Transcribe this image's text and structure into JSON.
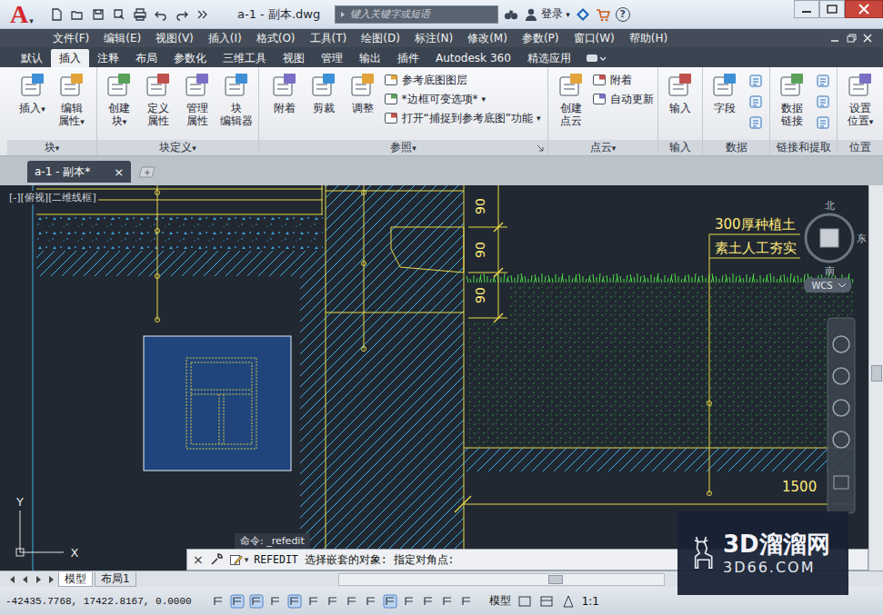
{
  "window": {
    "title": "a-1 - 副本.dwg",
    "logo": "A"
  },
  "search": {
    "placeholder": "键入关键字或短语"
  },
  "account": {
    "label": "登录",
    "help": "?"
  },
  "menu": [
    "文件(F)",
    "编辑(E)",
    "视图(V)",
    "插入(I)",
    "格式(O)",
    "工具(T)",
    "绘图(D)",
    "标注(N)",
    "修改(M)",
    "参数(P)",
    "窗口(W)",
    "帮助(H)"
  ],
  "ribbon_tabs": [
    {
      "label": "默认",
      "selected": false
    },
    {
      "label": "插入",
      "selected": true
    },
    {
      "label": "注释",
      "selected": false
    },
    {
      "label": "布局",
      "selected": false
    },
    {
      "label": "参数化",
      "selected": false
    },
    {
      "label": "三维工具",
      "selected": false
    },
    {
      "label": "视图",
      "selected": false
    },
    {
      "label": "管理",
      "selected": false
    },
    {
      "label": "输出",
      "selected": false
    },
    {
      "label": "插件",
      "selected": false
    },
    {
      "label": "Autodesk 360",
      "selected": false
    },
    {
      "label": "精选应用",
      "selected": false
    }
  ],
  "dropdown_glyph": "▾",
  "ribbon_panels": [
    {
      "title": "块",
      "dropdown": true,
      "launcher": false,
      "items": [
        {
          "label": "插入",
          "kind": "large",
          "dropdown": true
        },
        {
          "label": "编辑\n属性",
          "kind": "large",
          "dropdown": true
        }
      ]
    },
    {
      "title": "块定义",
      "dropdown": true,
      "launcher": false,
      "items": [
        {
          "label": "创建\n块",
          "kind": "large",
          "dropdown": true
        },
        {
          "label": "定义\n属性",
          "kind": "large",
          "dropdown": false
        },
        {
          "label": "管理\n属性",
          "kind": "large",
          "dropdown": false
        },
        {
          "label": "块\n编辑器",
          "kind": "large",
          "dropdown": false
        }
      ]
    },
    {
      "title": "参照",
      "dropdown": true,
      "launcher": true,
      "items": [
        {
          "label": "附着",
          "kind": "large",
          "dropdown": false
        },
        {
          "label": "剪裁",
          "kind": "large",
          "dropdown": false
        },
        {
          "label": "调整",
          "kind": "large",
          "dropdown": false
        },
        {
          "label": "参考底图图层",
          "kind": "small",
          "dropdown": false
        },
        {
          "label": "*边框可变选项*",
          "kind": "small",
          "dropdown": true
        },
        {
          "label": "打开“捕捉到参考底图”功能",
          "kind": "small",
          "dropdown": true
        }
      ]
    },
    {
      "title": "点云",
      "dropdown": true,
      "launcher": false,
      "items": [
        {
          "label": "创建\n点云",
          "kind": "large",
          "dropdown": false
        },
        {
          "label": "附着",
          "kind": "small",
          "dropdown": false
        },
        {
          "label": "自动更新",
          "kind": "small",
          "dropdown": false
        }
      ]
    },
    {
      "title": "输入",
      "dropdown": false,
      "launcher": false,
      "items": [
        {
          "label": "输入",
          "kind": "large",
          "dropdown": false
        }
      ]
    },
    {
      "title": "数据",
      "dropdown": false,
      "launcher": false,
      "items": [
        {
          "label": "字段",
          "kind": "large",
          "dropdown": false
        },
        {
          "kind": "icon",
          "dropdown": false
        },
        {
          "kind": "icon",
          "dropdown": false
        },
        {
          "kind": "icon",
          "dropdown": false
        }
      ]
    },
    {
      "title": "链接和提取",
      "dropdown": false,
      "launcher": false,
      "items": [
        {
          "label": "数据\n链接",
          "kind": "large",
          "dropdown": false
        },
        {
          "kind": "icon",
          "dropdown": false
        },
        {
          "kind": "icon",
          "dropdown": false
        },
        {
          "kind": "icon",
          "dropdown": false
        }
      ]
    },
    {
      "title": "位置",
      "dropdown": false,
      "launcher": false,
      "items": [
        {
          "label": "设置\n位置",
          "kind": "large",
          "dropdown": true
        }
      ]
    }
  ],
  "doc_tabs": [
    {
      "label": "a-1 - 副本*",
      "selected": true,
      "close": "×"
    }
  ],
  "viewport": {
    "label": "[-][俯视][二维线框]"
  },
  "drawing": {
    "dimensions": [
      "90",
      "90",
      "90"
    ],
    "notes": [
      "300厚种植土",
      "素土人工夯实"
    ],
    "length": "1500"
  },
  "viewcube": {
    "north": "北",
    "east": "东",
    "south": "南",
    "wcs": "WCS"
  },
  "ucs": {
    "x": "X",
    "y": "Y"
  },
  "command": {
    "close": "×",
    "history": "命令: _refedit",
    "prompt": "REFEDIT 选择嵌套的对象: 指定对角点:"
  },
  "layout_tabs": [
    {
      "label": "模型",
      "selected": true
    },
    {
      "label": "布局1",
      "selected": false
    }
  ],
  "status_bar": {
    "coordinates": "-42435.7768, 17422.8167, 0.0000",
    "toggles": [
      {
        "on": false
      },
      {
        "on": true
      },
      {
        "on": true
      },
      {
        "on": false
      },
      {
        "on": true
      },
      {
        "on": false
      },
      {
        "on": false
      },
      {
        "on": false
      },
      {
        "on": false
      },
      {
        "on": true
      },
      {
        "on": false
      },
      {
        "on": false
      },
      {
        "on": false
      },
      {
        "on": false
      }
    ],
    "space": "模型",
    "scale": "1:1"
  },
  "watermark": {
    "title": "3D溜溜网",
    "url": "3D66.COM"
  }
}
